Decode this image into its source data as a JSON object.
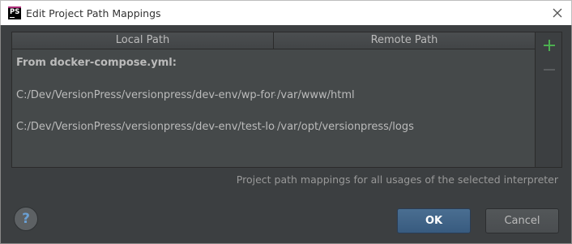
{
  "window": {
    "title": "Edit Project Path Mappings",
    "app_icon_text": "PS"
  },
  "table": {
    "columns": [
      "Local Path",
      "Remote Path"
    ],
    "group_label": "From docker-compose.yml:",
    "rows": [
      {
        "local": "C:/Dev/VersionPress/versionpress/dev-env/wp-for-tests",
        "remote": "/var/www/html"
      },
      {
        "local": "C:/Dev/VersionPress/versionpress/dev-env/test-logs",
        "remote": "/var/opt/versionpress/logs"
      }
    ]
  },
  "toolbar": {
    "add_icon": "plus-icon",
    "remove_icon": "minus-icon",
    "add_color": "#4caf50",
    "remove_color": "#5a5d5f"
  },
  "hint": "Project path mappings for all usages of the selected interpreter",
  "buttons": {
    "help": "?",
    "ok": "OK",
    "cancel": "Cancel"
  }
}
